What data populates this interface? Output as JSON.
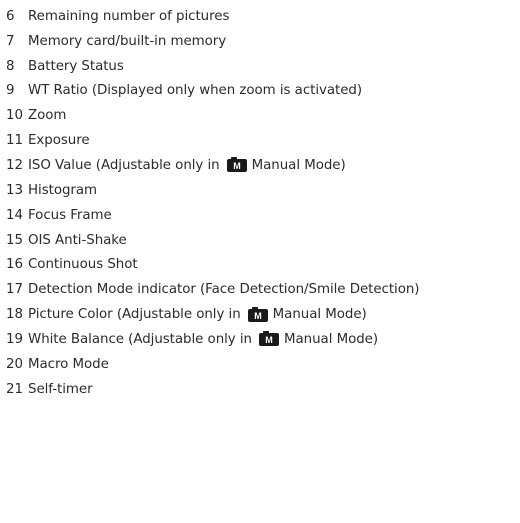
{
  "mode_icon": {
    "name": "camera-manual-mode-icon",
    "letter": "M",
    "color": "#1a1a1a",
    "letter_color": "#ffffff"
  },
  "items": [
    {
      "number": "6",
      "text": "Remaining number of pictures"
    },
    {
      "number": "7",
      "text": "Memory card/built-in memory"
    },
    {
      "number": "8",
      "text": "Battery Status"
    },
    {
      "number": "9",
      "text": "WT Ratio (Displayed only when zoom is activated)"
    },
    {
      "number": "10",
      "text": "Zoom"
    },
    {
      "number": "11",
      "text": "Exposure"
    },
    {
      "number": "12",
      "text": "ISO Value (Adjustable only in",
      "after_icon": "Manual Mode)"
    },
    {
      "number": "13",
      "text": "Histogram"
    },
    {
      "number": "14",
      "text": "Focus Frame"
    },
    {
      "number": "15",
      "text": "OIS Anti-Shake"
    },
    {
      "number": "16",
      "text": "Continuous Shot"
    },
    {
      "number": "17",
      "text": "Detection Mode indicator (Face Detection/Smile Detection)"
    },
    {
      "number": "18",
      "text": "Picture Color (Adjustable only in",
      "after_icon": "Manual Mode)"
    },
    {
      "number": "19",
      "text": "White Balance (Adjustable only in",
      "after_icon": "Manual Mode)"
    },
    {
      "number": "20",
      "text": "Macro Mode"
    },
    {
      "number": "21",
      "text": "Self-timer"
    }
  ]
}
